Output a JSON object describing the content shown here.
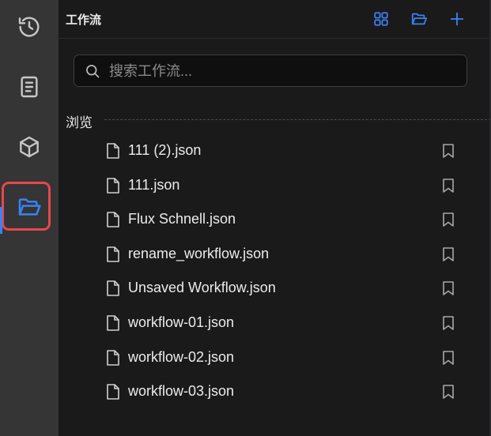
{
  "rail": {
    "items": [
      {
        "icon": "history-icon",
        "active": false
      },
      {
        "icon": "book-icon",
        "active": false
      },
      {
        "icon": "cube-icon",
        "active": false
      },
      {
        "icon": "folder-open-icon",
        "active": true
      }
    ]
  },
  "panel": {
    "title": "工作流",
    "header_buttons": [
      "grid-icon",
      "folder-open-icon",
      "plus-icon"
    ],
    "search": {
      "placeholder": "搜索工作流...",
      "value": ""
    },
    "section_label": "浏览",
    "files": [
      "111 (2).json",
      "111.json",
      "Flux Schnell.json",
      "rename_workflow.json",
      "Unsaved Workflow.json",
      "workflow-01.json",
      "workflow-02.json",
      "workflow-03.json"
    ]
  },
  "colors": {
    "accent": "#3b82f6",
    "highlight_border": "#e5484d",
    "rail_bg": "#353535",
    "panel_bg": "#1a1a1b"
  }
}
